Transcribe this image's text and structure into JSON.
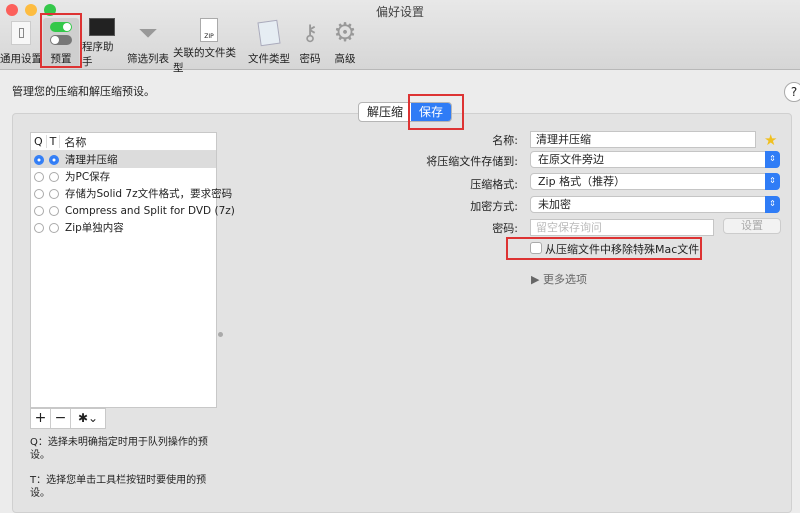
{
  "window": {
    "title": "偏好设置"
  },
  "toolbar": [
    {
      "label": "通用设置"
    },
    {
      "label": "预置"
    },
    {
      "label": "程序助手"
    },
    {
      "label": "筛选列表"
    },
    {
      "label": "关联的文件类型"
    },
    {
      "label": "文件类型"
    },
    {
      "label": "密码"
    },
    {
      "label": "高级"
    }
  ],
  "intro": "管理您的压缩和解压缩预设。",
  "help": "?",
  "segments": {
    "extract": "解压缩",
    "save": "保存"
  },
  "list": {
    "headers": {
      "q": "Q",
      "t": "T",
      "name": "名称"
    },
    "rows": [
      {
        "name": "清理并压缩"
      },
      {
        "name": "为PC保存"
      },
      {
        "name": "存储为Solid 7z文件格式，要求密码"
      },
      {
        "name": "Compress and Split for DVD (7z)"
      },
      {
        "name": "Zip单独内容"
      }
    ]
  },
  "list_buttons": {
    "add": "+",
    "remove": "−",
    "gear": "✱⌄"
  },
  "notes": {
    "q": "Q：选择未明确指定时用于队列操作的预设。",
    "t": "T：选择您单击工具栏按钮时要使用的预设。"
  },
  "form": {
    "name_label": "名称:",
    "name_value": "清理并压缩",
    "save_to_label": "将压缩文件存储到:",
    "save_to_value": "在原文件旁边",
    "format_label": "压缩格式:",
    "format_value": "Zip 格式（推荐）",
    "encrypt_label": "加密方式:",
    "encrypt_value": "未加密",
    "password_label": "密码:",
    "password_placeholder": "留空保存询问",
    "set_button": "设置",
    "remove_mac_label": "从压缩文件中移除特殊Mac文件",
    "more_options": "▶ 更多选项"
  },
  "colors": {
    "accent": "#2f7cf6",
    "highlight": "#dd3333"
  }
}
